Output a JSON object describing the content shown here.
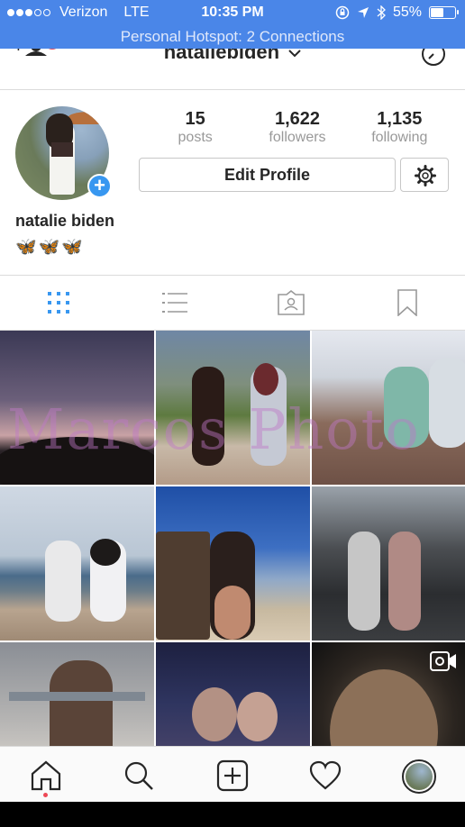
{
  "status_bar": {
    "carrier": "Verizon",
    "network": "LTE",
    "time": "10:35 PM",
    "battery": "55%",
    "battery_level": 0.55,
    "signal_bars_filled": 3,
    "signal_bars_total": 5
  },
  "hotspot_banner": "Personal Hotspot: 2 Connections",
  "header": {
    "username": "nataliebiden",
    "icons": [
      "add-user-icon",
      "chevron-down-icon",
      "history-icon"
    ]
  },
  "profile": {
    "stats": [
      {
        "value": "15",
        "label": "posts"
      },
      {
        "value": "1,622",
        "label": "followers"
      },
      {
        "value": "1,135",
        "label": "following"
      }
    ],
    "edit_button": "Edit Profile",
    "full_name": "natalie biden",
    "bio": "🦋🦋🦋"
  },
  "tabs": [
    "grid-view-icon",
    "list-view-icon",
    "tagged-photos-icon",
    "saved-icon"
  ],
  "grid": {
    "posts": 9,
    "video_post_index": 8
  },
  "watermark": "Marcos Photo",
  "bottom_nav": [
    "home-icon",
    "search-icon",
    "new-post-icon",
    "activity-heart-icon",
    "profile-avatar"
  ],
  "colors": {
    "status_bar": "#4a86e8",
    "accent_blue": "#3897f0",
    "notification_red": "#ed4956"
  }
}
